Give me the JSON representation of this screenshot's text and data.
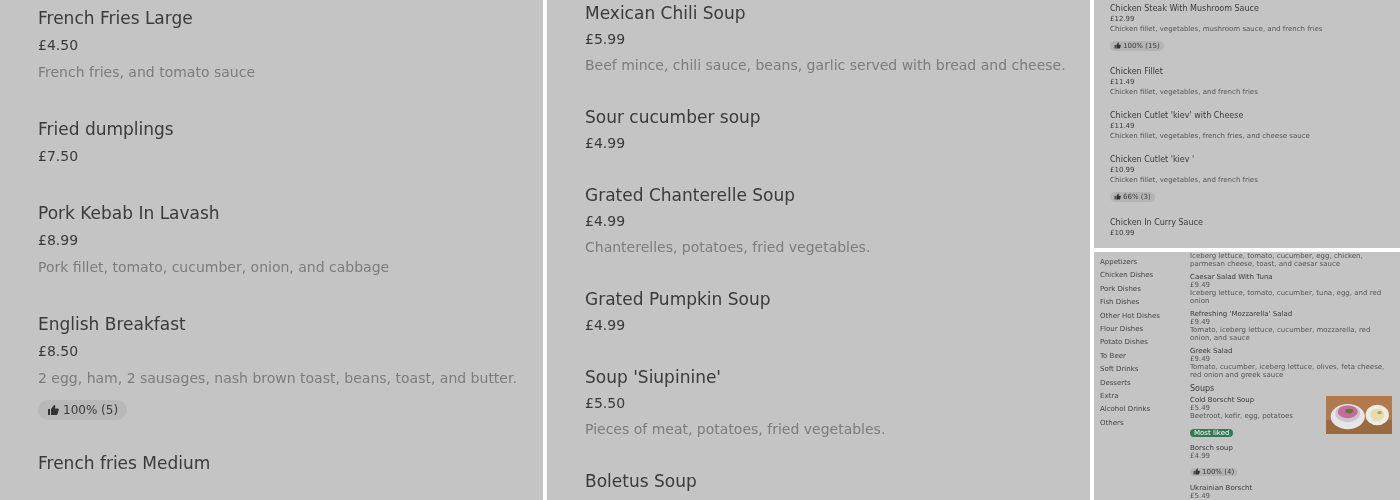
{
  "panels": [
    {
      "kind": "large",
      "items": [
        {
          "name": "French Fries Large",
          "price": "£4.50",
          "description": "French fries, and tomato sauce"
        },
        {
          "name": "Fried dumplings",
          "price": "£7.50"
        },
        {
          "name": "Pork Kebab In Lavash",
          "price": "£8.99",
          "description": "Pork fillet, tomato, cucumber, onion, and cabbage"
        },
        {
          "name": "English Breakfast",
          "price": "£8.50",
          "description": "2 egg, ham, 2 sausages, nash brown toast, beans, toast, and butter.",
          "rating": "100% (5)"
        },
        {
          "name": "French fries Medium"
        }
      ]
    },
    {
      "kind": "large",
      "items": [
        {
          "name": "Mexican Chili Soup",
          "price": "£5.99",
          "description": "Beef mince, chili sauce, beans, garlic served with bread and cheese."
        },
        {
          "name": "Sour cucumber soup",
          "price": "£4.99"
        },
        {
          "name": "Grated Chanterelle Soup",
          "price": "£4.99",
          "description": "Chanterelles, potatoes, fried vegetables."
        },
        {
          "name": "Grated Pumpkin Soup",
          "price": "£4.99"
        },
        {
          "name": "Soup 'Siupinine'",
          "price": "£5.50",
          "description": "Pieces of meat, potatoes, fried vegetables."
        },
        {
          "name": "Boletus Soup"
        }
      ]
    },
    {
      "kind": "small",
      "items": [
        {
          "name": "Chicken Steak With Mushroom Sauce",
          "price": "£12.99",
          "description": "Chicken fillet, vegetables, mushroom sauce, and french fries",
          "rating": "100% (15)"
        },
        {
          "name": "Chicken Fillet",
          "price": "£11.49",
          "description": "Chicken fillet, vegetables, and french fries"
        },
        {
          "name": "Chicken Cutlet 'kiev' with Cheese",
          "price": "£11.49",
          "description": "Chicken fillet, vegetables, french fries, and cheese sauce"
        },
        {
          "name": "Chicken Cutlet 'kiev '",
          "price": "£10.99",
          "description": "Chicken fillet, vegetables, and french fries",
          "rating": "66% (3)"
        },
        {
          "name": "Chicken In Curry Sauce",
          "price": "£10.99"
        }
      ]
    },
    {
      "kind": "tiny",
      "categories": [
        "Appetizers",
        "Chicken Dishes",
        "Pork Dishes",
        "Fish Dishes",
        "Other Hot Dishes",
        "Flour Dishes",
        "Potato Dishes",
        "To Beer",
        "Soft Drinks",
        "Desserts",
        "Extra",
        "Alcohol Drinks",
        "Others"
      ],
      "sections": [
        {
          "items": [
            {
              "description": "Iceberg lettuce, tomato, cucumber, egg, chicken, parmesan cheese, toast, and caesar sauce"
            },
            {
              "name": "Caesar Salad With Tuna",
              "price": "£9.49",
              "description": "Iceberg lettuce, tomato, cucumber, tuna, egg, and red onion"
            },
            {
              "name": "Refreshing 'Mozzarella' Salad",
              "price": "£9.49",
              "description": "Tomato, iceberg lettuce, cucumber, mozzarella, red onion, and sauce"
            },
            {
              "name": "Greek Salad",
              "price": "£9.49",
              "description": "Tomato, cucumber, iceberg lettuce, olives, feta cheese, red onion and greek sauce"
            }
          ]
        },
        {
          "title": "Soups",
          "items": [
            {
              "name": "Cold Borscht Soup",
              "price": "£5.49",
              "description": "Beetroot, kefir, egg, potatoes",
              "tag": "Most liked"
            },
            {
              "name": "Borsch soup",
              "price": "£4.99",
              "rating": "100% (4)"
            },
            {
              "name": "Ukrainian Borscht",
              "price": "£5.49"
            }
          ]
        }
      ]
    }
  ]
}
